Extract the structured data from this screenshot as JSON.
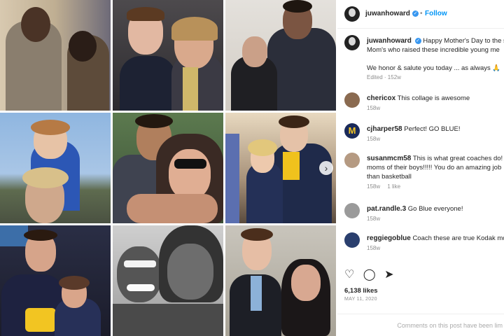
{
  "post": {
    "author": "juwanhoward",
    "follow_label": "Follow",
    "caption_line1": "Happy Mother's Day to the s",
    "caption_line2": "Mom's who raised these incredible young me",
    "caption_line3": "We honor & salute you today ... as always",
    "caption_emoji": "🙏",
    "caption_age": "Edited · 152w"
  },
  "comments": [
    {
      "user": "chericox",
      "text": "This collage is awesome",
      "age": "158w",
      "likes": ""
    },
    {
      "user": "cjharper58",
      "text": "Perfect! GO BLUE!",
      "age": "158w",
      "likes": ""
    },
    {
      "user": "susanmcm58",
      "text": "This is what great coaches do! Sh",
      "text2": "moms of their boys!!!!! You do an amazing job",
      "text3": "than basketball",
      "age": "158w",
      "likes": "1 like"
    },
    {
      "user": "pat.randle.3",
      "text": "Go Blue everyone!",
      "age": "158w",
      "likes": ""
    },
    {
      "user": "reggiegoblue",
      "text": "Coach these are true Kodak mo",
      "age": "158w",
      "likes": ""
    }
  ],
  "likes_count": "6,138 likes",
  "post_date": "MAY 11, 2020",
  "comments_disabled": "Comments on this post have been lim",
  "icons": {
    "nav": "chevron-right-icon",
    "like": "heart-icon",
    "comment": "comment-icon",
    "share": "share-icon"
  },
  "colors": {
    "accent": "#0095f6",
    "verified": "#3897f0",
    "text": "#262626",
    "muted": "#8e8e8e"
  }
}
